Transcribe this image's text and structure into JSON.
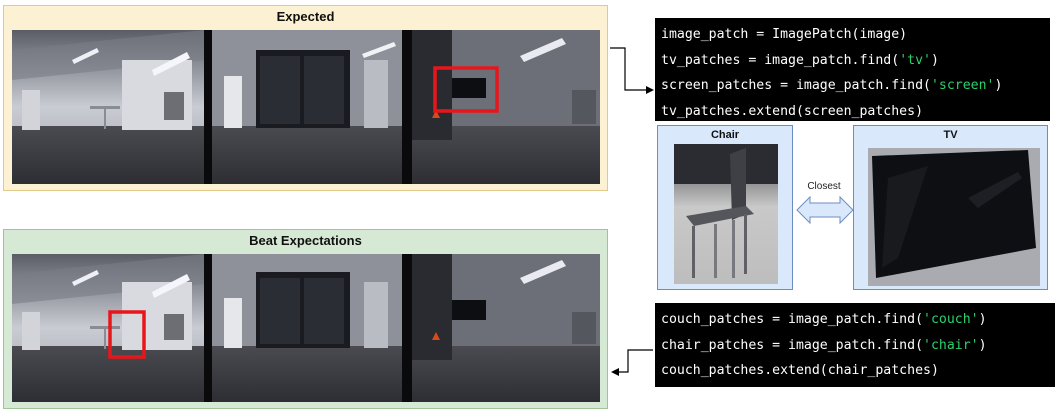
{
  "panels": {
    "expected": {
      "title": "Expected"
    },
    "beat": {
      "title": "Beat Expectations"
    }
  },
  "code_top": {
    "lines": [
      [
        {
          "t": "image_patch = ImagePatch(image)"
        }
      ],
      [
        {
          "t": "tv_patches = image_patch.find("
        },
        {
          "t": "'tv'",
          "s": 1
        },
        {
          "t": ")"
        }
      ],
      [
        {
          "t": "screen_patches = image_patch.find("
        },
        {
          "t": "'screen'",
          "s": 1
        },
        {
          "t": ")"
        }
      ],
      [
        {
          "t": "tv_patches.extend(screen_patches)"
        }
      ]
    ]
  },
  "code_bottom": {
    "lines": [
      [
        {
          "t": "couch_patches = image_patch.find("
        },
        {
          "t": "'couch'",
          "s": 1
        },
        {
          "t": ")"
        }
      ],
      [
        {
          "t": "chair_patches = image_patch.find("
        },
        {
          "t": "'chair'",
          "s": 1
        },
        {
          "t": ")"
        }
      ],
      [
        {
          "t": "couch_patches.extend(chair_patches)"
        }
      ]
    ]
  },
  "patches": {
    "chair": {
      "title": "Chair"
    },
    "tv": {
      "title": "TV"
    }
  },
  "relation": {
    "label": "Closest"
  },
  "colors": {
    "highlight_box": "#e8161b",
    "expected_bg": "#fcf1d2",
    "beat_bg": "#d6e9d4",
    "patch_bg": "#dae8fc",
    "code_string": "#2bd16b"
  }
}
